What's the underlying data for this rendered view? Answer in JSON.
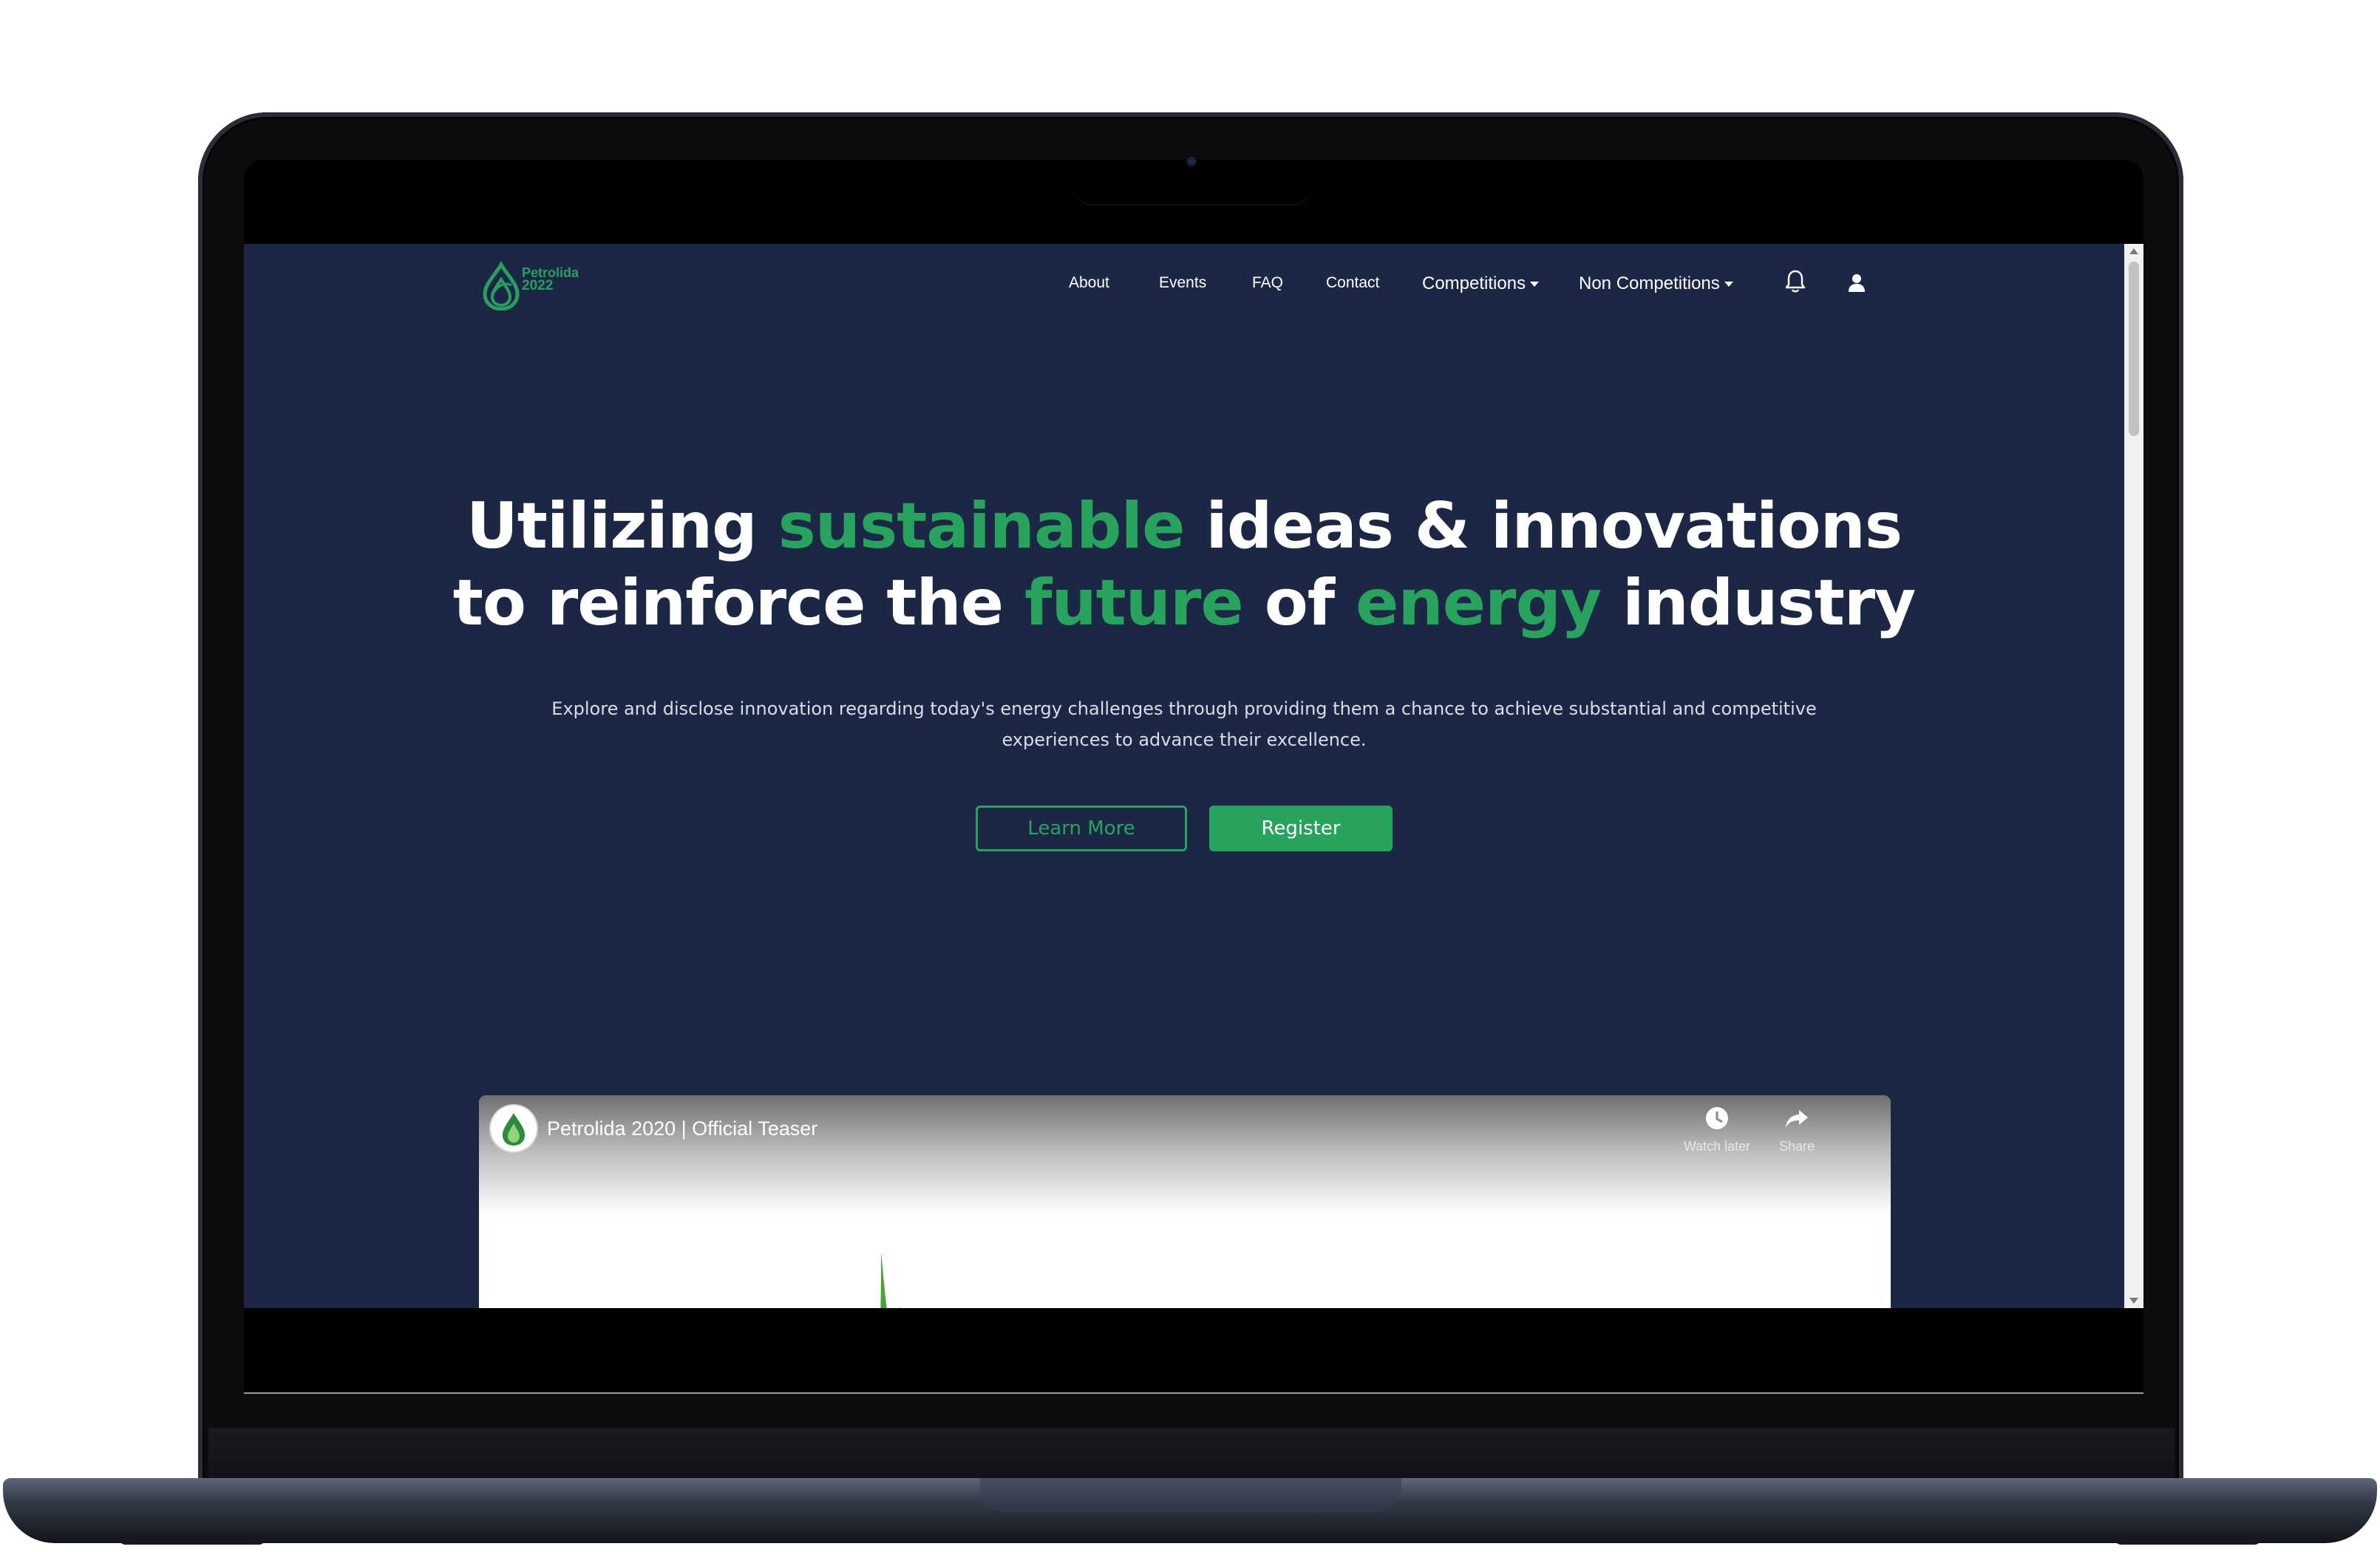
{
  "brand": {
    "logo_name": "Petrolida",
    "logo_year": "2022",
    "accent_color": "#27a35e",
    "background_color": "#1c2746"
  },
  "nav": {
    "links": [
      "About",
      "Events",
      "FAQ",
      "Contact"
    ],
    "dropdowns": [
      "Competitions",
      "Non Competitions"
    ],
    "icons": [
      "bell-icon",
      "user-icon"
    ]
  },
  "hero": {
    "line1": {
      "part1": "Utilizing ",
      "green1": "sustainable",
      "part2": " ideas & innovations"
    },
    "line2": {
      "part1": "to reinforce the ",
      "green1": "future",
      "part2": " of ",
      "green2": "energy",
      "part3": " industry"
    },
    "subtitle": "Explore and disclose innovation regarding today's energy challenges through providing them a chance to achieve substantial and competitive experiences to advance their excellence.",
    "learn_more_label": "Learn More",
    "register_label": "Register"
  },
  "video": {
    "title": "Petrolida 2020 | Official Teaser",
    "watch_later_label": "Watch later",
    "share_label": "Share"
  }
}
